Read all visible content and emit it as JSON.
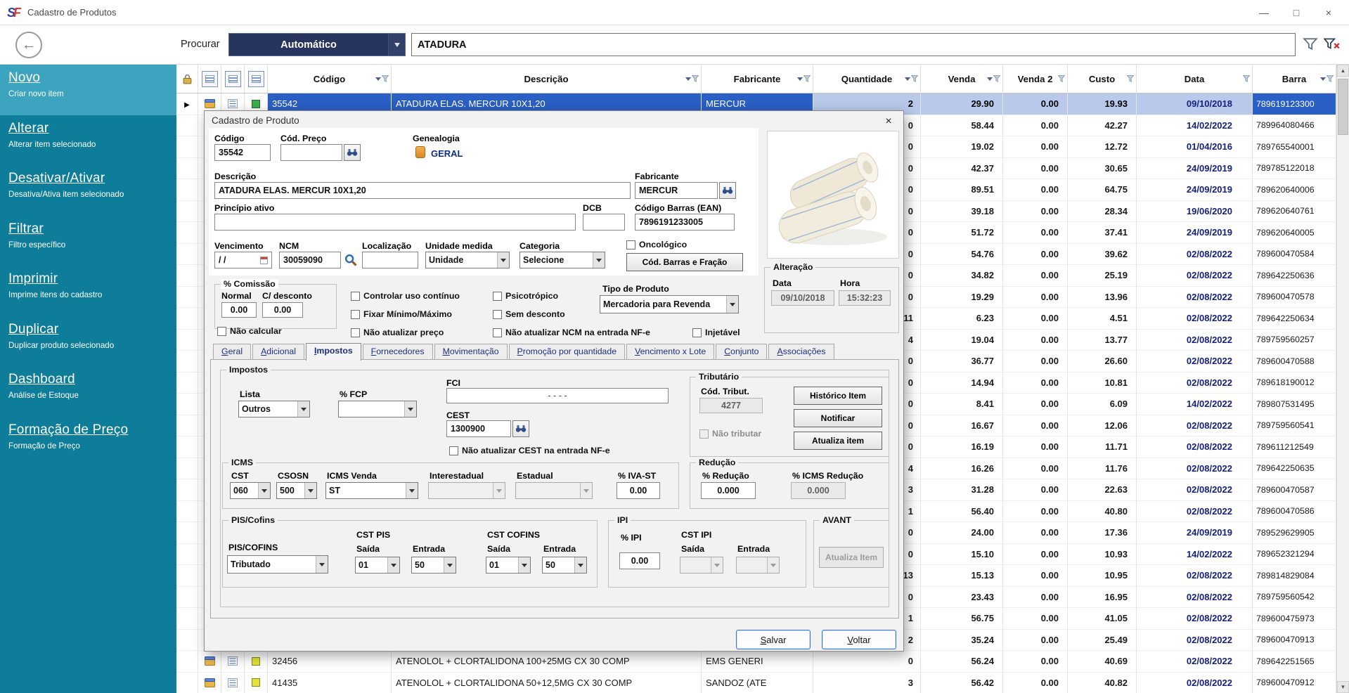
{
  "window": {
    "logo_s": "S",
    "logo_f": "F",
    "title": "Cadastro de Produtos",
    "minimize": "—",
    "maximize": "□",
    "close": "×"
  },
  "icons": {
    "up": "▲",
    "down": "▼",
    "back": "←"
  },
  "toolbar": {
    "procurar": "Procurar",
    "mode": "Automático",
    "search": "ATADURA"
  },
  "sidebar": {
    "items": [
      {
        "title": "Novo",
        "subtitle": "Criar novo item",
        "selected": true
      },
      {
        "title": "Alterar",
        "subtitle": "Alterar item selecionado"
      },
      {
        "title": "Desativar/Ativar",
        "subtitle": "Desativa/Ativa item selecionado"
      },
      {
        "title": "Filtrar",
        "subtitle": "Filtro específico"
      },
      {
        "title": "Imprimir",
        "subtitle": "Imprime itens do cadastro"
      },
      {
        "title": "Duplicar",
        "subtitle": "Duplicar produto selecionado"
      },
      {
        "title": "Dashboard",
        "subtitle": "Análise de Estoque"
      },
      {
        "title": "Formação de Preço",
        "subtitle": "Formação de Preço"
      }
    ]
  },
  "table": {
    "columns": [
      {
        "label": "Código",
        "sort": true
      },
      {
        "label": "Descrição",
        "sort": true
      },
      {
        "label": "Fabricante",
        "sort": true
      },
      {
        "label": "Quantidade",
        "sort": true
      },
      {
        "label": "Venda",
        "sort": true
      },
      {
        "label": "Venda 2",
        "sort": false
      },
      {
        "label": "Custo",
        "sort": false
      },
      {
        "label": "Data",
        "sort": false
      },
      {
        "label": "Barra",
        "sort": true
      }
    ],
    "rows": [
      {
        "selected": true,
        "marker": true,
        "status_color": "#3fae4c",
        "codigo": "35542",
        "descricao": "ATADURA ELAS. MERCUR 10X1,20",
        "fabricante": "MERCUR",
        "qtd": "2",
        "venda": "29.90",
        "venda2": "0.00",
        "custo": "19.93",
        "data": "09/10/2018",
        "barra": "789619123300"
      },
      {
        "status_color": "#3fae4c",
        "codigo": "",
        "descricao": "",
        "fabricante": "",
        "qtd": "0",
        "venda": "58.44",
        "venda2": "0.00",
        "custo": "42.27",
        "data": "14/02/2022",
        "barra": "789964080466"
      },
      {
        "status_color": "#3fae4c",
        "codigo": "",
        "descricao": "",
        "fabricante": "",
        "qtd": "0",
        "venda": "19.02",
        "venda2": "0.00",
        "custo": "12.72",
        "data": "01/04/2016",
        "barra": "789765540001"
      },
      {
        "status_color": "#3fae4c",
        "codigo": "",
        "descricao": "",
        "fabricante": "",
        "qtd": "0",
        "venda": "42.37",
        "venda2": "0.00",
        "custo": "30.65",
        "data": "24/09/2019",
        "barra": "789785122018"
      },
      {
        "status_color": "#3fae4c",
        "codigo": "",
        "descricao": "",
        "fabricante": "",
        "qtd": "0",
        "venda": "89.51",
        "venda2": "0.00",
        "custo": "64.75",
        "data": "24/09/2019",
        "barra": "789620640006"
      },
      {
        "status_color": "#3fae4c",
        "codigo": "",
        "descricao": "",
        "fabricante": "",
        "qtd": "0",
        "venda": "39.18",
        "venda2": "0.00",
        "custo": "28.34",
        "data": "19/06/2020",
        "barra": "789620640761"
      },
      {
        "status_color": "#3fae4c",
        "codigo": "",
        "descricao": "",
        "fabricante": "",
        "qtd": "0",
        "venda": "51.72",
        "venda2": "0.00",
        "custo": "37.41",
        "data": "24/09/2019",
        "barra": "789620640005"
      },
      {
        "status_color": "#3fae4c",
        "codigo": "",
        "descricao": "",
        "fabricante": "",
        "qtd": "0",
        "venda": "54.76",
        "venda2": "0.00",
        "custo": "39.62",
        "data": "02/08/2022",
        "barra": "789600470584"
      },
      {
        "status_color": "#3fae4c",
        "codigo": "",
        "descricao": "",
        "fabricante": "",
        "qtd": "0",
        "venda": "34.82",
        "venda2": "0.00",
        "custo": "25.19",
        "data": "02/08/2022",
        "barra": "789642250636"
      },
      {
        "status_color": "#3fae4c",
        "codigo": "",
        "descricao": "",
        "fabricante": "",
        "qtd": "0",
        "venda": "19.29",
        "venda2": "0.00",
        "custo": "13.96",
        "data": "02/08/2022",
        "barra": "789600470578"
      },
      {
        "status_color": "#3fae4c",
        "codigo": "",
        "descricao": "",
        "fabricante": "",
        "qtd": "11",
        "venda": "6.23",
        "venda2": "0.00",
        "custo": "4.51",
        "data": "02/08/2022",
        "barra": "789642250634"
      },
      {
        "status_color": "#3fae4c",
        "codigo": "",
        "descricao": "",
        "fabricante": "",
        "qtd": "4",
        "venda": "19.04",
        "venda2": "0.00",
        "custo": "13.77",
        "data": "02/08/2022",
        "barra": "789759560257"
      },
      {
        "status_color": "#3fae4c",
        "codigo": "",
        "descricao": "",
        "fabricante": "",
        "qtd": "0",
        "venda": "36.77",
        "venda2": "0.00",
        "custo": "26.60",
        "data": "02/08/2022",
        "barra": "789600470588"
      },
      {
        "status_color": "#3fae4c",
        "codigo": "",
        "descricao": "",
        "fabricante": "",
        "qtd": "0",
        "venda": "14.94",
        "venda2": "0.00",
        "custo": "10.81",
        "data": "02/08/2022",
        "barra": "789618190012"
      },
      {
        "status_color": "#3fae4c",
        "codigo": "",
        "descricao": "",
        "fabricante": "",
        "qtd": "0",
        "venda": "8.41",
        "venda2": "0.00",
        "custo": "6.09",
        "data": "14/02/2022",
        "barra": "789807531495"
      },
      {
        "status_color": "#3fae4c",
        "codigo": "",
        "descricao": "",
        "fabricante": "",
        "qtd": "0",
        "venda": "16.67",
        "venda2": "0.00",
        "custo": "12.06",
        "data": "02/08/2022",
        "barra": "789759560541"
      },
      {
        "status_color": "#3fae4c",
        "codigo": "",
        "descricao": "",
        "fabricante": "",
        "qtd": "0",
        "venda": "16.19",
        "venda2": "0.00",
        "custo": "11.71",
        "data": "02/08/2022",
        "barra": "789611212549"
      },
      {
        "status_color": "#3fae4c",
        "codigo": "",
        "descricao": "",
        "fabricante": "",
        "qtd": "4",
        "venda": "16.26",
        "venda2": "0.00",
        "custo": "11.76",
        "data": "02/08/2022",
        "barra": "789642250635"
      },
      {
        "status_color": "#3fae4c",
        "codigo": "",
        "descricao": "",
        "fabricante": "",
        "qtd": "3",
        "venda": "31.28",
        "venda2": "0.00",
        "custo": "22.63",
        "data": "02/08/2022",
        "barra": "789600470587"
      },
      {
        "status_color": "#3fae4c",
        "codigo": "",
        "descricao": "",
        "fabricante": "",
        "qtd": "1",
        "venda": "56.40",
        "venda2": "0.00",
        "custo": "40.80",
        "data": "02/08/2022",
        "barra": "789600470586"
      },
      {
        "status_color": "#3fae4c",
        "codigo": "",
        "descricao": "",
        "fabricante": "",
        "qtd": "0",
        "venda": "24.00",
        "venda2": "0.00",
        "custo": "17.36",
        "data": "24/09/2019",
        "barra": "789529629905"
      },
      {
        "status_color": "#3fae4c",
        "codigo": "",
        "descricao": "",
        "fabricante": "",
        "qtd": "0",
        "venda": "15.10",
        "venda2": "0.00",
        "custo": "10.93",
        "data": "14/02/2022",
        "barra": "789652321294"
      },
      {
        "status_color": "#3fae4c",
        "codigo": "",
        "descricao": "",
        "fabricante": "",
        "qtd": "13",
        "venda": "15.13",
        "venda2": "0.00",
        "custo": "10.95",
        "data": "02/08/2022",
        "barra": "789814829084"
      },
      {
        "status_color": "#3fae4c",
        "codigo": "",
        "descricao": "",
        "fabricante": "",
        "qtd": "0",
        "venda": "23.43",
        "venda2": "0.00",
        "custo": "16.95",
        "data": "02/08/2022",
        "barra": "789759560542"
      },
      {
        "status_color": "#3fae4c",
        "codigo": "",
        "descricao": "",
        "fabricante": "",
        "qtd": "1",
        "venda": "56.75",
        "venda2": "0.00",
        "custo": "41.05",
        "data": "02/08/2022",
        "barra": "789600475973"
      },
      {
        "status_color": "#3fae4c",
        "codigo": "",
        "descricao": "",
        "fabricante": "",
        "qtd": "2",
        "venda": "35.24",
        "venda2": "0.00",
        "custo": "25.49",
        "data": "02/08/2022",
        "barra": "789600470913"
      },
      {
        "status_color": "#e2e23a",
        "codigo": "32456",
        "descricao": "ATENOLOL + CLORTALIDONA 100+25MG CX 30 COMP",
        "fabricante": "EMS GENERI",
        "qtd": "0",
        "venda": "56.24",
        "venda2": "0.00",
        "custo": "40.69",
        "data": "02/08/2022",
        "barra": "789642251565"
      },
      {
        "status_color": "#e2e23a",
        "codigo": "41435",
        "descricao": "ATENOLOL + CLORTALIDONA 50+12,5MG CX 30 COMP",
        "fabricante": "SANDOZ (ATE",
        "qtd": "3",
        "venda": "56.42",
        "venda2": "0.00",
        "custo": "40.82",
        "data": "02/08/2022",
        "barra": "789600470912"
      }
    ]
  },
  "dialog": {
    "title": "Cadastro de Produto",
    "close": "×",
    "codigo_label": "Código",
    "codigo": "35542",
    "cod_preco_label": "Cód. Preço",
    "cod_preco": "",
    "genealogia_label": "Genealogia",
    "genealogia": "GERAL",
    "descricao_label": "Descrição",
    "descricao": "ATADURA ELAS. MERCUR 10X1,20",
    "fabricante_label": "Fabricante",
    "fabricante": "MERCUR",
    "principio_label": "Princípio ativo",
    "principio": "",
    "dcb_label": "DCB",
    "dcb": "",
    "ean_label": "Código Barras (EAN)",
    "ean": "7896191233005",
    "vencimento_label": "Vencimento",
    "vencimento": "/ /",
    "ncm_label": "NCM",
    "ncm": "30059090",
    "localizacao_label": "Localização",
    "localizacao": "",
    "unidade_label": "Unidade medida",
    "unidade": "Unidade",
    "categoria_label": "Categoria",
    "categoria": "Selecione",
    "oncologico": "Oncológico",
    "btn_cod_barras": "Cód. Barras e Fração",
    "comissao_group": "% Comissão",
    "normal_label": "Normal",
    "normal": "0.00",
    "cdesc_label": "C/ desconto",
    "cdesc": "0.00",
    "nao_calcular": "Não calcular",
    "chk_uso_continuo": "Controlar uso contínuo",
    "chk_fixar": "Fixar Mínimo/Máximo",
    "chk_nao_atualizar_preco": "Não atualizar preço",
    "chk_psicotropico": "Psicotrópico",
    "chk_sem_desconto": "Sem desconto",
    "chk_nao_atualizar_ncm": "Não atualizar NCM na entrada NF-e",
    "chk_injetavel": "Injetável",
    "tipo_produto_label": "Tipo de Produto",
    "tipo_produto": "Mercadoria para Revenda",
    "alteracao_group": "Alteração",
    "data_label": "Data",
    "hora_label": "Hora",
    "alt_data": "09/10/2018",
    "alt_hora": "15:32:23",
    "tabs": [
      "Geral",
      "Adicional",
      "Impostos",
      "Fornecedores",
      "Movimentação",
      "Promoção por quantidade",
      "Vencimento x Lote",
      "Conjunto",
      "Associações"
    ],
    "active_tab": "Impostos",
    "impostos": {
      "group": "Impostos",
      "lista_label": "Lista",
      "lista": "Outros",
      "fcp_label": "% FCP",
      "fcp": "",
      "fci_label": "FCI",
      "fci": "-   -   -   -",
      "cest_label": "CEST",
      "cest": "1300900",
      "chk_cest": "Não atualizar CEST na entrada NF-e",
      "tributario_group": "Tributário",
      "cod_tribut_label": "Cód. Tribut.",
      "cod_tribut": "4277",
      "nao_tributar": "Não tributar",
      "btn_historico": "Histórico Item",
      "btn_notificar": "Notificar",
      "btn_atualiza_item": "Atualiza item",
      "icms_group": "ICMS",
      "cst_label": "CST",
      "cst": "060",
      "csosn_label": "CSOSN",
      "csosn": "500",
      "icms_venda_label": "ICMS Venda",
      "icms_venda": "ST",
      "interestadual_label": "Interestadual",
      "estadual_label": "Estadual",
      "iva_label": "% IVA-ST",
      "iva": "0.00",
      "reducao_group": "Redução",
      "reducao_label": "% Redução",
      "reducao": "0.000",
      "icms_reducao_label": "% ICMS Redução",
      "icms_reducao": "0.000",
      "pis_group": "PIS/Cofins",
      "piscofins_label": "PIS/COFINS",
      "piscofins": "Tributado",
      "cst_pis_label": "CST PIS",
      "saida_label": "Saída",
      "entrada_label": "Entrada",
      "pis_saida": "01",
      "pis_entrada": "50",
      "cst_cofins_label": "CST COFINS",
      "cofins_saida": "01",
      "cofins_entrada": "50",
      "ipi_group": "IPI",
      "ipi_label": "% IPI",
      "ipi": "0.00",
      "cst_ipi_label": "CST IPI",
      "avant_group": "AVANT",
      "btn_avant": "Atualiza Item"
    },
    "salvar": "Salvar",
    "voltar": "Voltar"
  }
}
